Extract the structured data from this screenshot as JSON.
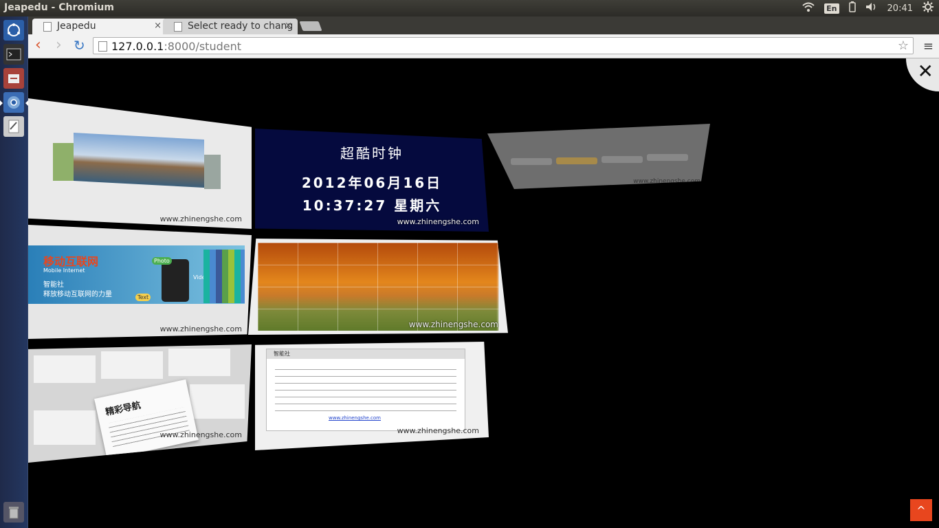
{
  "window": {
    "title": "Jeapedu - Chromium"
  },
  "tray": {
    "keyboard": "En",
    "time": "20:41"
  },
  "tabs": [
    {
      "label": "Jeapedu",
      "close": "×"
    },
    {
      "label": "Select ready to chang",
      "close": "×"
    }
  ],
  "omnibox": {
    "host": "127.0.0.1",
    "path": ":8000/student"
  },
  "gallery": {
    "close": "✕",
    "watermark": "www.zhinengshe.com",
    "clock": {
      "title": "超酷时钟",
      "date": "2012年06月16日",
      "time": "10:37:27 星期六"
    },
    "mobile": {
      "title": "移动互联网",
      "subtitle": "Mobile Internet",
      "brand": "智能社",
      "slogan": "释放移动互联网的力量",
      "bubble1": "Photo",
      "bubble2": "Video",
      "bubble3": "Text"
    },
    "nav_card": {
      "title": "精彩导航"
    },
    "info_card": {
      "header": "智能社",
      "link": "www.zhinengshe.com"
    }
  },
  "scroll_top": {
    "label": "^"
  }
}
